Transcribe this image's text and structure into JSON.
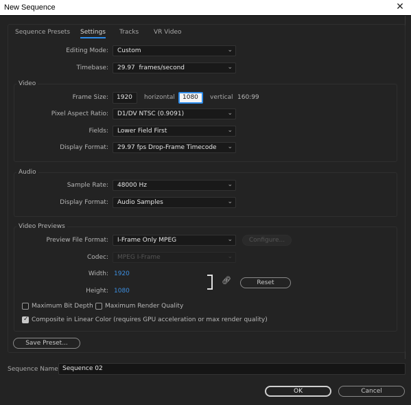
{
  "window": {
    "title": "New Sequence",
    "close_icon": "close-icon"
  },
  "tabs": [
    {
      "label": "Sequence Presets",
      "active": false
    },
    {
      "label": "Settings",
      "active": true
    },
    {
      "label": "Tracks",
      "active": false
    },
    {
      "label": "VR Video",
      "active": false
    }
  ],
  "general": {
    "editing_mode": {
      "label": "Editing Mode:",
      "value": "Custom"
    },
    "timebase": {
      "label": "Timebase:",
      "value": "29.97  frames/second"
    }
  },
  "video": {
    "title": "Video",
    "frame_size": {
      "label": "Frame Size:",
      "width": "1920",
      "horizontal_label": "horizontal",
      "height": "1080",
      "vertical_label": "vertical",
      "ratio": "160:99"
    },
    "pixel_aspect_ratio": {
      "label": "Pixel Aspect Ratio:",
      "value": "D1/DV NTSC (0.9091)"
    },
    "fields": {
      "label": "Fields:",
      "value": "Lower Field First"
    },
    "display_format": {
      "label": "Display Format:",
      "value": "29.97 fps Drop-Frame Timecode"
    }
  },
  "audio": {
    "title": "Audio",
    "sample_rate": {
      "label": "Sample Rate:",
      "value": "48000 Hz"
    },
    "display_format": {
      "label": "Display Format:",
      "value": "Audio Samples"
    }
  },
  "video_previews": {
    "title": "Video Previews",
    "preview_file_format": {
      "label": "Preview File Format:",
      "value": "I-Frame Only MPEG"
    },
    "configure_label": "Configure...",
    "codec": {
      "label": "Codec:",
      "value": "MPEG I-Frame"
    },
    "width": {
      "label": "Width:",
      "value": "1920"
    },
    "height": {
      "label": "Height:",
      "value": "1080"
    },
    "reset_label": "Reset",
    "max_bit_depth": {
      "label": "Maximum Bit Depth",
      "checked": false
    },
    "max_render_quality": {
      "label": "Maximum Render Quality",
      "checked": false
    },
    "composite_linear": {
      "label": "Composite in Linear Color (requires GPU acceleration or max render quality)",
      "checked": true
    }
  },
  "save_preset_label": "Save Preset...",
  "sequence_name": {
    "label": "Sequence Name:",
    "value": "Sequence 02"
  },
  "buttons": {
    "ok": "OK",
    "cancel": "Cancel"
  },
  "colors": {
    "accent": "#2d8ceb",
    "value_blue": "#3d8fe0",
    "background": "#232323"
  }
}
